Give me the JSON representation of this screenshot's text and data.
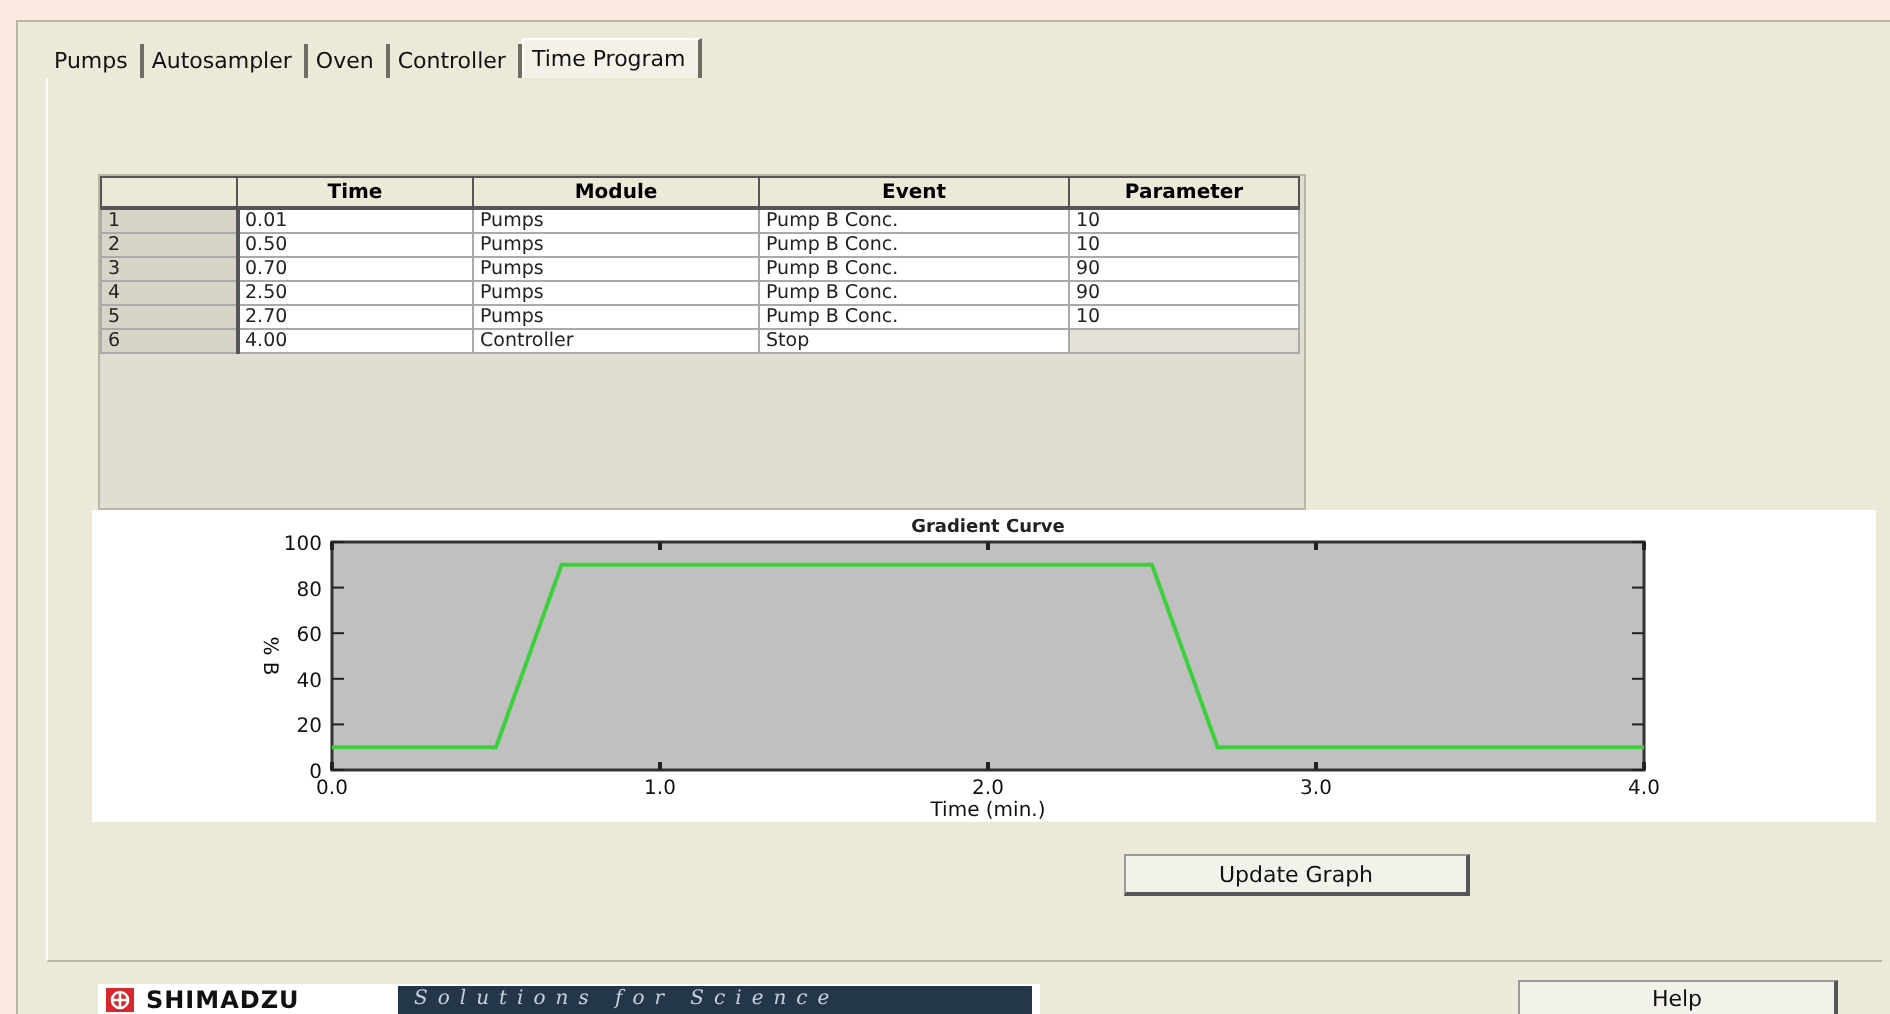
{
  "tabs": [
    {
      "label": "Pumps",
      "selected": false
    },
    {
      "label": "Autosampler",
      "selected": false
    },
    {
      "label": "Oven",
      "selected": false
    },
    {
      "label": "Controller",
      "selected": false
    },
    {
      "label": "Time Program",
      "selected": true
    }
  ],
  "table": {
    "columns": [
      "Time",
      "Module",
      "Event",
      "Parameter"
    ],
    "rows": [
      {
        "index": "1",
        "cells": [
          "0.01",
          "Pumps",
          "Pump B Conc.",
          "10"
        ]
      },
      {
        "index": "2",
        "cells": [
          "0.50",
          "Pumps",
          "Pump B Conc.",
          "10"
        ]
      },
      {
        "index": "3",
        "cells": [
          "0.70",
          "Pumps",
          "Pump B Conc.",
          "90"
        ]
      },
      {
        "index": "4",
        "cells": [
          "2.50",
          "Pumps",
          "Pump B Conc.",
          "90"
        ]
      },
      {
        "index": "5",
        "cells": [
          "2.70",
          "Pumps",
          "Pump B Conc.",
          "10"
        ]
      },
      {
        "index": "6",
        "cells": [
          "4.00",
          "Controller",
          "Stop",
          ""
        ]
      }
    ]
  },
  "chart": {
    "chart_data": {
      "type": "line",
      "title": "Gradient Curve",
      "xlabel": "Time (min.)",
      "ylabel": "% B",
      "x": [
        0,
        0.5,
        0.7,
        2.5,
        2.7,
        4
      ],
      "series": [
        {
          "color": "#3ecf3e",
          "values": [
            10,
            10,
            90,
            90,
            10,
            10
          ]
        }
      ],
      "xlim": [
        0,
        4
      ],
      "ylim": [
        0,
        100
      ],
      "xticks": [
        {
          "value": 0,
          "label": "0.0"
        },
        {
          "value": 1,
          "label": "1.0"
        },
        {
          "value": 2,
          "label": "2.0"
        },
        {
          "value": 3,
          "label": "3.0"
        },
        {
          "value": 4,
          "label": "4.0"
        }
      ],
      "yticks": [
        0,
        20,
        40,
        60,
        80,
        100
      ]
    }
  },
  "update_button": "Update Graph",
  "logo": {
    "brand": "SHIMADZU",
    "tagline": "Solutions for Science"
  },
  "help_button": "Help"
}
